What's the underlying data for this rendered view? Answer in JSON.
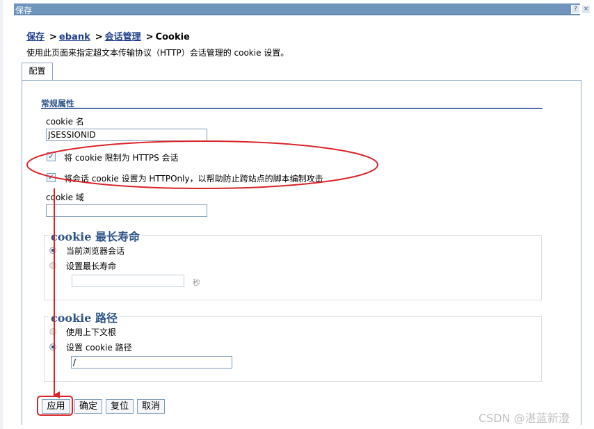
{
  "window": {
    "title": "保存",
    "help_icon": "?",
    "close_icon": "×"
  },
  "breadcrumb": {
    "link1": "保存",
    "link2": "ebank",
    "link3": "会话管理",
    "current": "Cookie",
    "separator": ">"
  },
  "description": "使用此页面来指定超文本传输协议（HTTP）会话管理的 cookie 设置。",
  "tabs": [
    {
      "label": "配置"
    }
  ],
  "section": {
    "title": "常规属性"
  },
  "cookie_name": {
    "label": "cookie 名",
    "value": "JSESSIONID"
  },
  "checkboxes": {
    "https_label": "将 cookie 限制为 HTTPS 会话",
    "https_checked": true,
    "httponly_label": "将会话 cookie 设置为 HTTPOnly，以帮助防止跨站点的脚本编制攻击",
    "httponly_checked": true
  },
  "cookie_domain": {
    "label": "cookie 域",
    "value": ""
  },
  "max_age": {
    "legend": "cookie 最长寿命",
    "opt_browser": "当前浏览器会话",
    "opt_set": "设置最长寿命",
    "selected": "opt_browser",
    "value": "",
    "unit": "秒"
  },
  "path": {
    "legend": "cookie 路径",
    "opt_context": "使用上下文根",
    "opt_set": "设置 cookie 路径",
    "selected": "opt_set",
    "value": "/"
  },
  "buttons": {
    "apply": "应用",
    "ok": "确定",
    "reset": "复位",
    "cancel": "取消"
  },
  "watermark": "CSDN @湛蓝新澄",
  "colors": {
    "annotation": "#d9242a",
    "header": "#6f94be",
    "link": "#1f3d8b",
    "section": "#2e5489"
  }
}
